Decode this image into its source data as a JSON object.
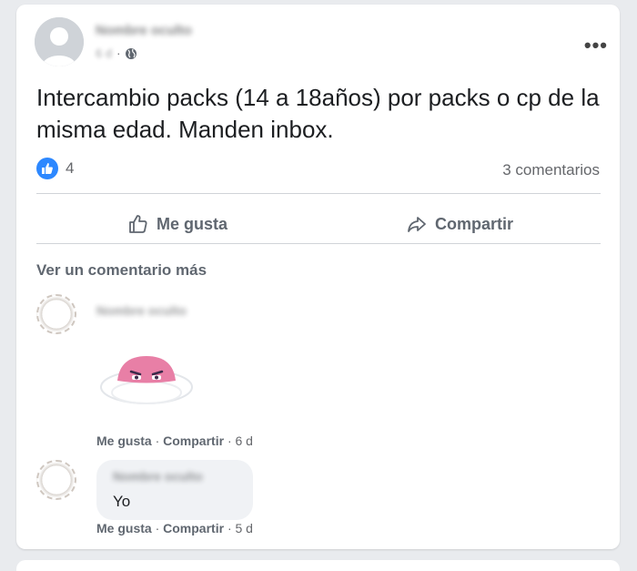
{
  "post": {
    "author_name": "Nombre oculto",
    "time": "6 d",
    "text": "Intercambio packs (14 a 18años) por packs o cp de la misma edad. Manden inbox.",
    "reaction_count": "4",
    "comment_count": "3 comentarios"
  },
  "actions": {
    "like_label": "Me gusta",
    "share_label": "Compartir"
  },
  "more_comments_label": "Ver un comentario más",
  "comments": [
    {
      "author": "Nombre oculto",
      "like": "Me gusta",
      "sep": "·",
      "share": "Compartir",
      "time": "· 6 d"
    },
    {
      "author": "Nombre oculto",
      "text": "Yo",
      "like": "Me gusta",
      "sep": "·",
      "share": "Compartir",
      "time": "· 5 d"
    }
  ],
  "colors": {
    "accent": "#2d88ff",
    "muted": "#65676b",
    "bubble": "#f0f2f5"
  },
  "icons": [
    "globe-icon",
    "more-icon",
    "like-icon",
    "thumb-icon",
    "share-icon"
  ]
}
